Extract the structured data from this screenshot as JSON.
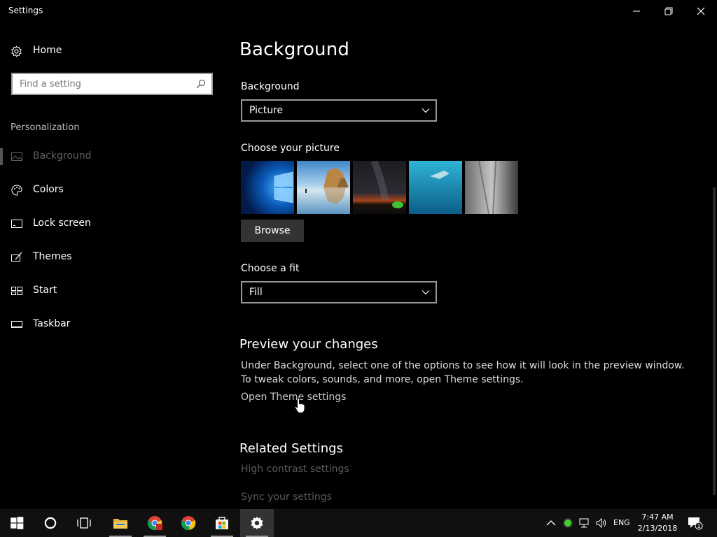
{
  "window": {
    "title": "Settings"
  },
  "sidebar": {
    "home_label": "Home",
    "search_placeholder": "Find a setting",
    "section_label": "Personalization",
    "items": [
      {
        "label": "Background",
        "icon": "picture-icon",
        "active": true
      },
      {
        "label": "Colors",
        "icon": "palette-icon",
        "active": false
      },
      {
        "label": "Lock screen",
        "icon": "lock-screen-icon",
        "active": false
      },
      {
        "label": "Themes",
        "icon": "themes-icon",
        "active": false
      },
      {
        "label": "Start",
        "icon": "start-icon",
        "active": false
      },
      {
        "label": "Taskbar",
        "icon": "taskbar-icon",
        "active": false
      }
    ]
  },
  "main": {
    "page_title": "Background",
    "background_label": "Background",
    "background_value": "Picture",
    "choose_picture_label": "Choose your picture",
    "browse_label": "Browse",
    "fit_label": "Choose a fit",
    "fit_value": "Fill",
    "preview_heading": "Preview your changes",
    "preview_text": "Under Background, select one of the options to see how it will look in the preview window. To tweak colors, sounds, and more, open Theme settings.",
    "open_theme_link": "Open Theme settings",
    "related_heading": "Related Settings",
    "related_links": [
      "High contrast settings",
      "Sync your settings"
    ]
  },
  "taskbar": {
    "language": "ENG",
    "time": "7:47 AM",
    "date": "2/13/2018",
    "notification_count": "1"
  },
  "colors": {
    "background": "#000000",
    "taskbar": "#101010",
    "active_taskbar": "#333333",
    "browse_button": "#333333"
  }
}
